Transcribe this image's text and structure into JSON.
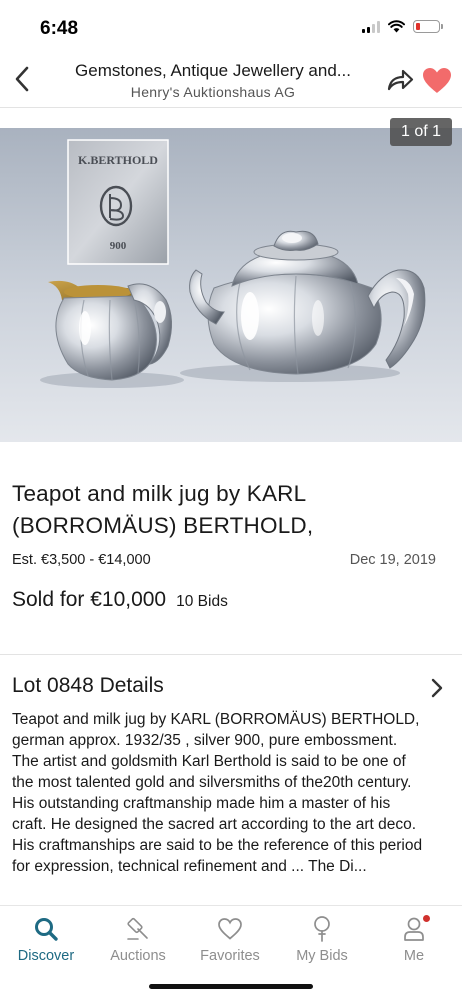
{
  "status_bar": {
    "time": "6:48"
  },
  "header": {
    "title": "Gemstones, Antique Jewellery and...",
    "subtitle": "Henry's Auktionshaus AG",
    "icons": {
      "back": "chevron-left-icon",
      "share": "share-arrow-icon",
      "favorite": "heart-icon"
    },
    "favorite_color": "#f26b6b"
  },
  "image": {
    "counter": "1 of 1",
    "hallmark_lines": [
      "K.BERTHOLD",
      "900"
    ]
  },
  "lot": {
    "title": "Teapot and milk jug by KARL (BORROMÄUS) BERTHOLD,",
    "estimate": "Est. €3,500 - €14,000",
    "date": "Dec 19, 2019",
    "sold": "Sold for €10,000",
    "bids": "10 Bids"
  },
  "details": {
    "title": "Lot 0848 Details",
    "description": "Teapot and milk jug by KARL (BORROMÄUS) BERTHOLD, german approx. 1932/35 , silver 900, pure embossment. The artist and goldsmith Karl Berthold is said to be one of the most talented gold and silversmiths of the20th century. His outstanding craftmanship made him a master of his craft. He designed the sacred art according to the art deco. His craftmanships are said to be the reference of this period for expression, technical refinement and ... The Di..."
  },
  "tabs": [
    {
      "label": "Discover",
      "icon": "search-icon",
      "active": true
    },
    {
      "label": "Auctions",
      "icon": "gavel-icon",
      "active": false
    },
    {
      "label": "Favorites",
      "icon": "heart-outline-icon",
      "active": false
    },
    {
      "label": "My Bids",
      "icon": "paddle-icon",
      "active": false
    },
    {
      "label": "Me",
      "icon": "user-icon",
      "active": false,
      "has_notification": true
    }
  ],
  "colors": {
    "accent": "#1e6a83",
    "tab_inactive": "#8e8e8e",
    "notification": "#d0312d"
  }
}
